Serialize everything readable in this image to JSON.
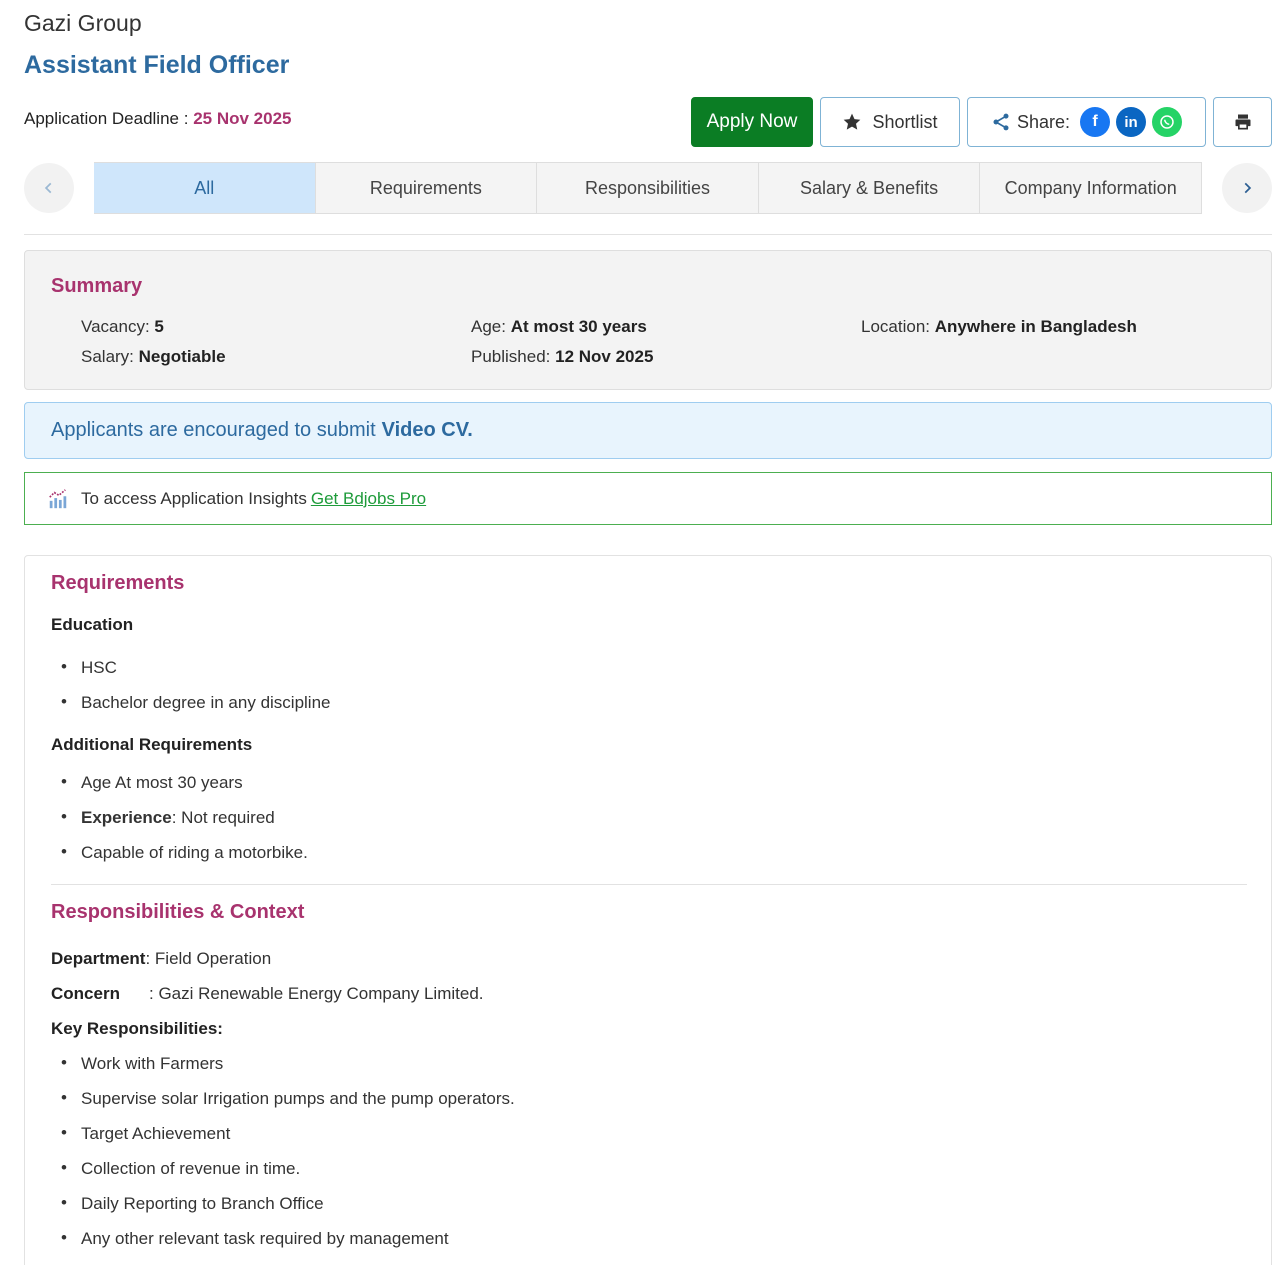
{
  "company": "Gazi Group",
  "job_title": "Assistant Field Officer",
  "deadline": {
    "label": "Application Deadline :",
    "date": "25 Nov 2025"
  },
  "actions": {
    "apply": "Apply Now",
    "shortlist": "Shortlist",
    "share": "Share:",
    "share_icons": [
      "facebook-icon",
      "linkedin-icon",
      "whatsapp-icon"
    ]
  },
  "tabs": [
    {
      "label": "All",
      "active": true
    },
    {
      "label": "Requirements",
      "active": false
    },
    {
      "label": "Responsibilities",
      "active": false
    },
    {
      "label": "Salary & Benefits",
      "active": false
    },
    {
      "label": "Company Information",
      "active": false
    }
  ],
  "summary": {
    "title": "Summary",
    "vacancy_label": "Vacancy:",
    "vacancy": "5",
    "age_label": "Age:",
    "age": "At most 30 years",
    "location_label": "Location:",
    "location": "Anywhere in Bangladesh",
    "salary_label": "Salary:",
    "salary": "Negotiable",
    "published_label": "Published:",
    "published": "12 Nov 2025"
  },
  "video_cv": {
    "text": "Applicants are encouraged to submit",
    "bold": "Video CV."
  },
  "insights": {
    "text": "To access Application Insights",
    "link": "Get Bdjobs Pro"
  },
  "requirements": {
    "title": "Requirements",
    "education_label": "Education",
    "education": [
      "HSC",
      "Bachelor degree in any discipline"
    ],
    "additional_label": "Additional Requirements",
    "additional": {
      "age": "Age At most 30 years",
      "experience_label": "Experience",
      "experience_value": ": Not required",
      "other": "Capable of riding a motorbike."
    }
  },
  "responsibilities": {
    "title": "Responsibilities & Context",
    "department_label": "Department",
    "department_value": ": Field Operation",
    "concern_label": "Concern",
    "concern_value": ": Gazi Renewable Energy Company Limited.",
    "key_label": "Key Responsibilities:",
    "items": [
      "Work with Farmers",
      "Supervise solar Irrigation pumps and the pump operators.",
      "Target Achievement",
      "Collection of revenue in time.",
      "Daily Reporting to Branch Office",
      "Any other relevant task required by management"
    ]
  },
  "colors": {
    "accent": "#a8336e",
    "title_blue": "#2d6a9f",
    "apply_green": "#0b7d24"
  }
}
